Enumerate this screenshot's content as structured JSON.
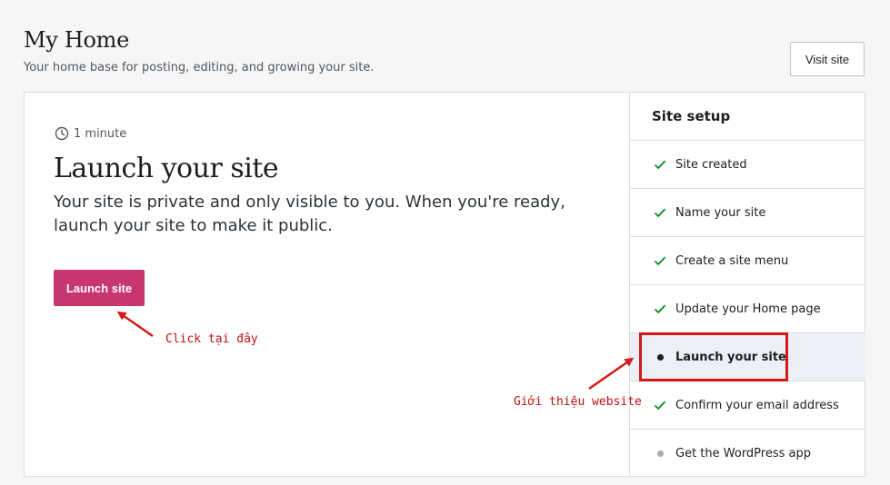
{
  "header": {
    "title": "My Home",
    "subtitle": "Your home base for posting, editing, and growing your site.",
    "visit_label": "Visit site"
  },
  "task": {
    "duration": "1 minute",
    "title": "Launch your site",
    "description": "Your site is private and only visible to you. When you're ready, launch your site to make it public.",
    "button_label": "Launch site"
  },
  "setup": {
    "title": "Site setup",
    "items": [
      {
        "label": "Site created",
        "status": "done"
      },
      {
        "label": "Name your site",
        "status": "done"
      },
      {
        "label": "Create a site menu",
        "status": "done"
      },
      {
        "label": "Update your Home page",
        "status": "done"
      },
      {
        "label": "Launch your site",
        "status": "current"
      },
      {
        "label": "Confirm your email address",
        "status": "done"
      },
      {
        "label": "Get the WordPress app",
        "status": "pending"
      }
    ]
  },
  "annotations": {
    "click_here": "Click tại đây",
    "intro": "Giới thiệu website"
  },
  "colors": {
    "accent": "#c9356e",
    "check": "#008a20",
    "annotation": "#d81717",
    "current_bg": "#eaf0f5"
  }
}
